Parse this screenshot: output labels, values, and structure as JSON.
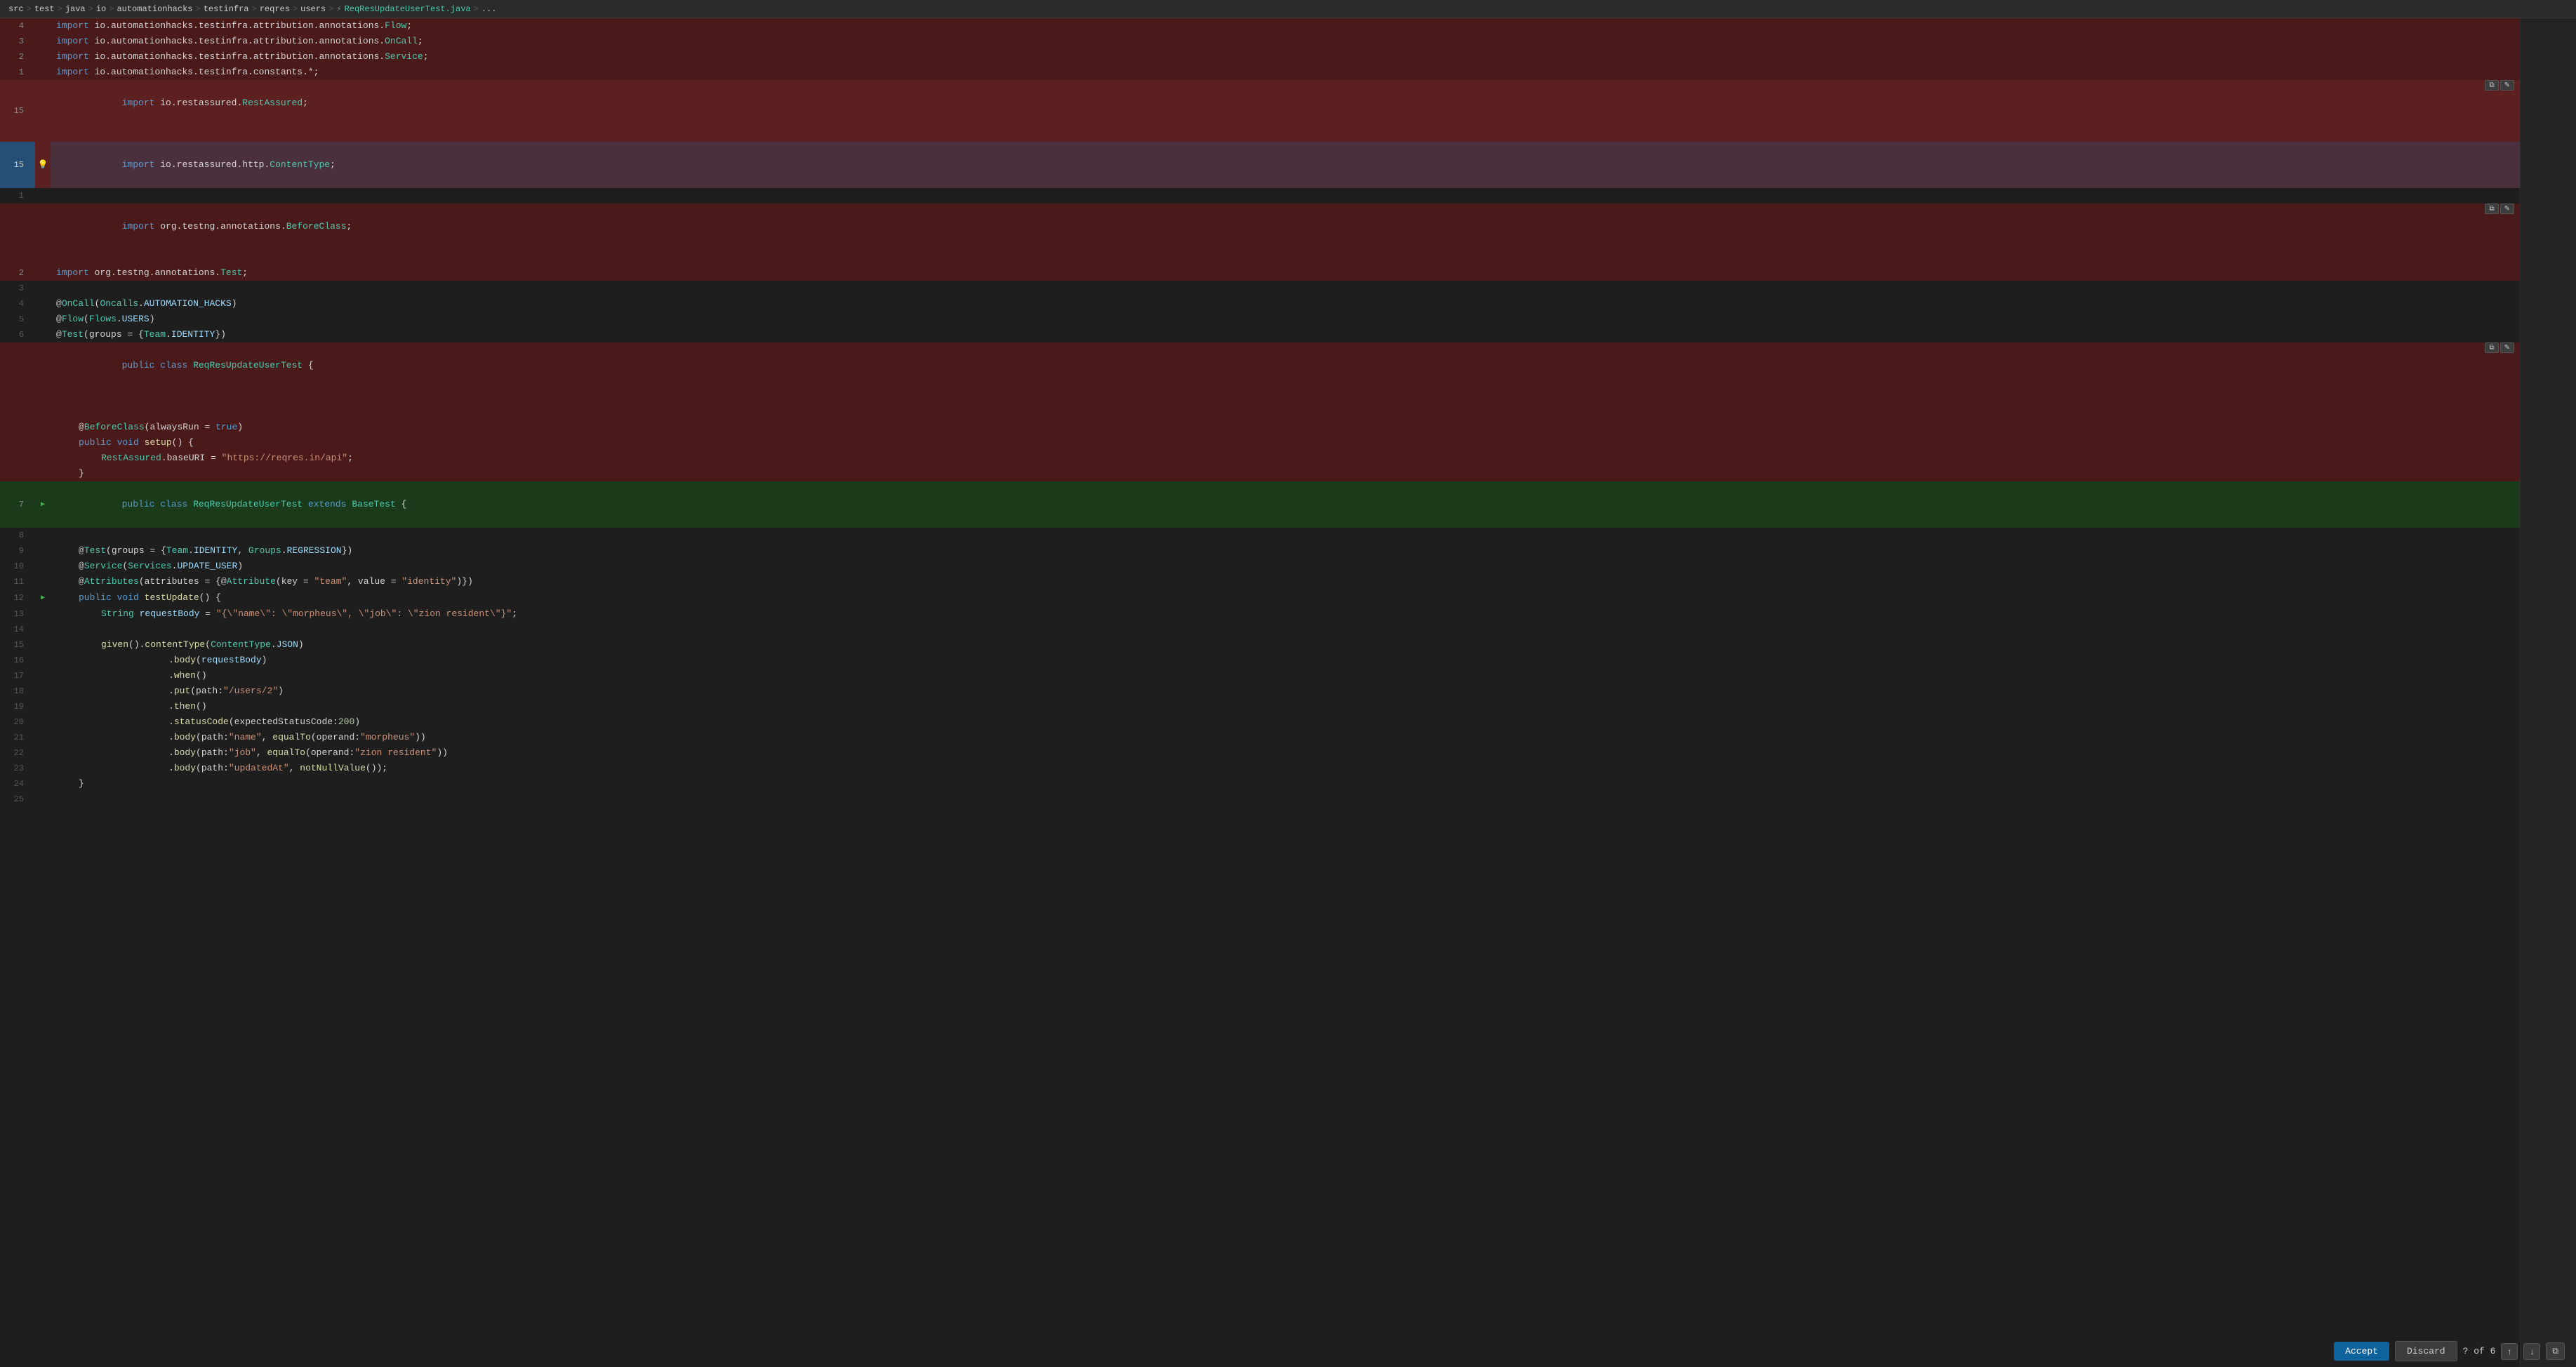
{
  "breadcrumb": {
    "parts": [
      "src",
      ">",
      "test",
      ">",
      "java",
      ">",
      "io",
      ">",
      "automationhacks",
      ">",
      "testinfra",
      ">",
      "reqres",
      ">",
      "users",
      ">",
      "⚡",
      "ReqResUpdateUserTest.java",
      ">",
      "..."
    ]
  },
  "toolbar": {
    "accept_label": "Accept",
    "discard_label": "Discard",
    "nav_counter": "? of 6",
    "nav_up": "↑",
    "nav_down": "↓",
    "expand": "⧉"
  },
  "lines": [
    {
      "num": "4",
      "type": "deleted",
      "code": "import io.automationhacks.testinfra.attribution.annotations.Flow;"
    },
    {
      "num": "3",
      "type": "deleted",
      "code": "import io.automationhacks.testinfra.attribution.annotations.OnCall;"
    },
    {
      "num": "2",
      "type": "deleted",
      "code": "import io.automationhacks.testinfra.attribution.annotations.Service;"
    },
    {
      "num": "1",
      "type": "deleted",
      "code": "import io.automationhacks.testinfra.constants.*;"
    },
    {
      "num": "15",
      "type": "deleted-highlight",
      "code": "import io.restassured.RestAssured;",
      "hasAction": true
    },
    {
      "num": "15",
      "type": "deleted-highlight",
      "code": "import io.restassured.http.ContentType;",
      "isCurrent": true,
      "hasLightbulb": true
    },
    {
      "num": "1",
      "type": "normal",
      "code": ""
    },
    {
      "num": "",
      "type": "deleted",
      "code": "import org.testng.annotations.BeforeClass;",
      "hasAction2": true
    },
    {
      "num": "2",
      "type": "deleted",
      "code": "import org.testng.annotations.Test;"
    },
    {
      "num": "3",
      "type": "normal",
      "code": ""
    },
    {
      "num": "4",
      "type": "normal",
      "code": "@OnCall(Oncalls.AUTOMATION_HACKS)"
    },
    {
      "num": "5",
      "type": "normal",
      "code": "@Flow(Flows.USERS)"
    },
    {
      "num": "6",
      "type": "normal",
      "code": "@Test(groups = {Team.IDENTITY})"
    },
    {
      "num": "",
      "type": "deleted",
      "code": "public class ReqResUpdateUserTest {",
      "hasAction2": true
    },
    {
      "num": "",
      "type": "deleted",
      "code": ""
    },
    {
      "num": "",
      "type": "deleted",
      "code": "    @BeforeClass(alwaysRun = true)"
    },
    {
      "num": "",
      "type": "deleted",
      "code": "    public void setup() {"
    },
    {
      "num": "",
      "type": "deleted",
      "code": "        RestAssured.baseURI = \"https://reqres.in/api\";"
    },
    {
      "num": "",
      "type": "deleted",
      "code": "    }"
    },
    {
      "num": "7",
      "type": "added",
      "code": "public class ReqResUpdateUserTest extends BaseTest {",
      "hasRun": true
    },
    {
      "num": "8",
      "type": "normal",
      "code": ""
    },
    {
      "num": "9",
      "type": "normal",
      "code": "    @Test(groups = {Team.IDENTITY, Groups.REGRESSION})"
    },
    {
      "num": "10",
      "type": "normal",
      "code": "    @Service(Services.UPDATE_USER)"
    },
    {
      "num": "11",
      "type": "normal",
      "code": "    @Attributes(attributes = {@Attribute(key = \"team\", value = \"identity\")})"
    },
    {
      "num": "12",
      "type": "normal",
      "code": "    public void testUpdate() {",
      "hasRun2": true
    },
    {
      "num": "13",
      "type": "normal",
      "code": "        String requestBody = \"{\\\"name\\\": \\\"morpheus\\\", \\\"job\\\": \\\"zion resident\\\"}\";"
    },
    {
      "num": "14",
      "type": "normal",
      "code": ""
    },
    {
      "num": "15",
      "type": "normal",
      "code": "        given().contentType(ContentType.JSON)"
    },
    {
      "num": "16",
      "type": "normal",
      "code": "                .body(requestBody)"
    },
    {
      "num": "17",
      "type": "normal",
      "code": "                .when()"
    },
    {
      "num": "18",
      "type": "normal",
      "code": "                .put(path:\"/users/2\")"
    },
    {
      "num": "19",
      "type": "normal",
      "code": "                .then()"
    },
    {
      "num": "20",
      "type": "normal",
      "code": "                .statusCode(expectedStatusCode:200)"
    },
    {
      "num": "21",
      "type": "normal",
      "code": "                .body(path:\"name\", equalTo(operand:\"morpheus\"))"
    },
    {
      "num": "22",
      "type": "normal",
      "code": "                .body(path:\"job\", equalTo(operand:\"zion resident\"))"
    },
    {
      "num": "23",
      "type": "normal",
      "code": "                .body(path:\"updatedAt\", notNullValue());"
    },
    {
      "num": "24",
      "type": "normal",
      "code": "    }"
    },
    {
      "num": "25",
      "type": "normal",
      "code": ""
    }
  ]
}
